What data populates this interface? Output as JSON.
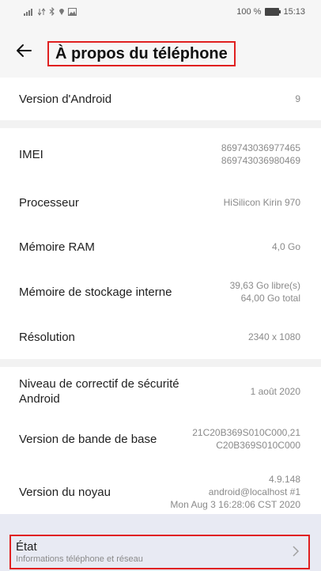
{
  "status_bar": {
    "left_icons": "↓░ ℡ ✱ ♦ ⌂",
    "battery_text": "100 %",
    "time": "15:13"
  },
  "header": {
    "title": "À propos du téléphone"
  },
  "rows": {
    "android_version": {
      "label": "Version d'Android",
      "value": "9"
    },
    "imei": {
      "label": "IMEI",
      "value_1": "869743036977465",
      "value_2": "869743036980469"
    },
    "processor": {
      "label": "Processeur",
      "value": "HiSilicon Kirin 970"
    },
    "ram": {
      "label": "Mémoire RAM",
      "value": "4,0 Go"
    },
    "storage": {
      "label": "Mémoire de stockage interne",
      "value_1": "39,63  Go libre(s)",
      "value_2": "64,00  Go total"
    },
    "resolution": {
      "label": "Résolution",
      "value": "2340 x 1080"
    },
    "security_patch": {
      "label_1": "Niveau de correctif de sécurité",
      "label_2": "Android",
      "value": "1 août 2020"
    },
    "baseband": {
      "label": "Version de bande de base",
      "value_1": "21C20B369S010C000,21",
      "value_2": "C20B369S010C000"
    },
    "kernel": {
      "label": "Version du noyau",
      "value_1": "4.9.148",
      "value_2": "android@localhost #1",
      "value_3": "Mon Aug 3 16:28:06 CST 2020"
    }
  },
  "etat": {
    "title": "État",
    "subtitle": "Informations téléphone et réseau"
  }
}
